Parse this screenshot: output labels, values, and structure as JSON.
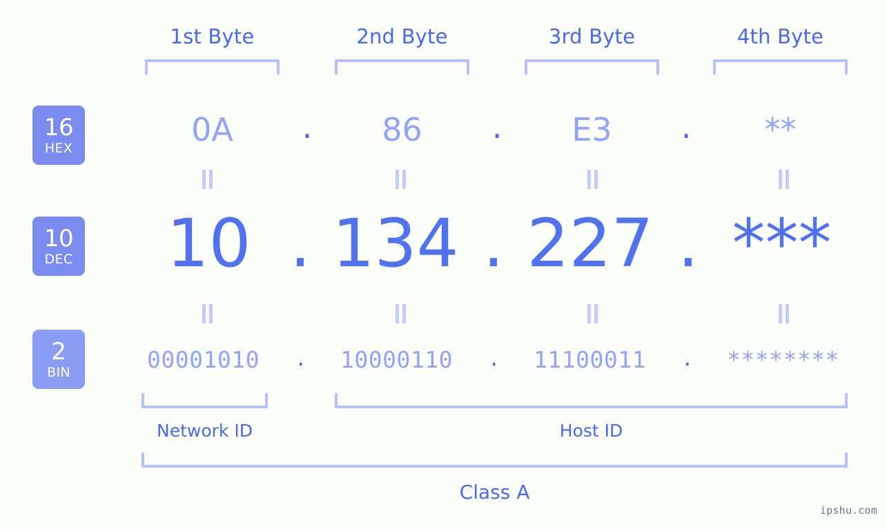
{
  "background_color": "#fbfdf8",
  "accent_color": "#4a68ef",
  "value_color": "#5172ef",
  "muted_color": "#93a3f7",
  "bracket_color": "#b6c0fb",
  "headers": {
    "byte1": "1st Byte",
    "byte2": "2nd Byte",
    "byte3": "3rd Byte",
    "byte4": "4th Byte"
  },
  "bases": [
    {
      "num": "16",
      "name": "HEX",
      "color": "#7b8cf0"
    },
    {
      "num": "10",
      "name": "DEC",
      "color": "#7b8cf0"
    },
    {
      "num": "2",
      "name": "BIN",
      "color": "#8b9cf5"
    }
  ],
  "rows": {
    "hex": {
      "base_num": "16",
      "base_name": "HEX",
      "values": [
        "0A",
        "86",
        "E3",
        "**"
      ],
      "separator": "."
    },
    "dec": {
      "base_num": "10",
      "base_name": "DEC",
      "values": [
        "10",
        "134",
        "227",
        "***"
      ],
      "separator": "."
    },
    "bin": {
      "base_num": "2",
      "base_name": "BIN",
      "values": [
        "00001010",
        "10000110",
        "11100011",
        "********"
      ],
      "separator": "."
    }
  },
  "equality_symbol": "=",
  "sections": {
    "network_id": "Network ID",
    "host_id": "Host ID",
    "ip_class": "Class A"
  },
  "watermark": "ipshu.com"
}
